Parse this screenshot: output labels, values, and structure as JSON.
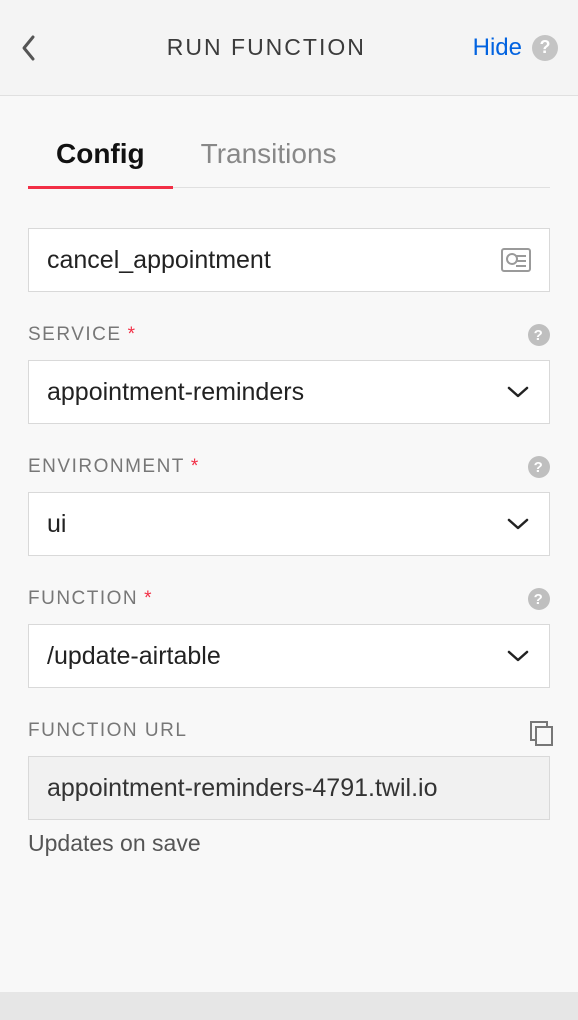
{
  "header": {
    "title": "RUN FUNCTION",
    "hide_label": "Hide"
  },
  "tabs": {
    "config": "Config",
    "transitions": "Transitions"
  },
  "name_field": {
    "value": "cancel_appointment"
  },
  "service": {
    "label": "SERVICE",
    "value": "appointment-reminders"
  },
  "environment": {
    "label": "ENVIRONMENT",
    "value": "ui"
  },
  "function": {
    "label": "FUNCTION",
    "value": "/update-airtable"
  },
  "function_url": {
    "label": "FUNCTION URL",
    "value": "appointment-reminders-4791.twil.io",
    "hint": "Updates on save"
  }
}
